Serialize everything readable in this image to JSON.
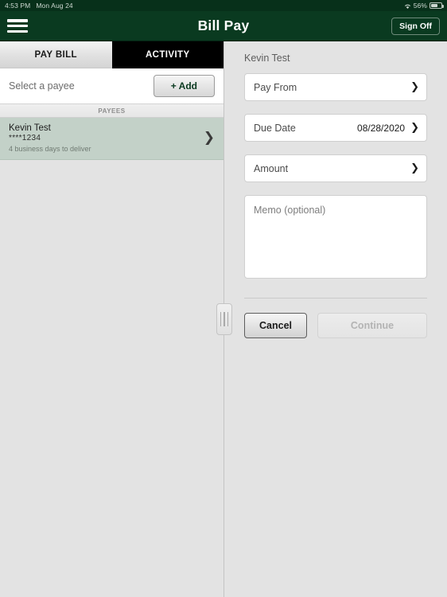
{
  "status_bar": {
    "time": "4:53 PM",
    "date": "Mon Aug 24",
    "wifi_icon": "wifi-icon",
    "battery_percent": "56%",
    "battery_icon": "battery-icon"
  },
  "nav": {
    "menu_icon": "hamburger-menu-icon",
    "title": "Bill Pay",
    "sign_off_label": "Sign Off"
  },
  "tabs": [
    {
      "label": "PAY BILL",
      "active": true
    },
    {
      "label": "ACTIVITY",
      "active": false
    }
  ],
  "payee_panel": {
    "select_label": "Select a payee",
    "add_button_label": "+ Add",
    "section_header": "PAYEES",
    "payees": [
      {
        "name": "Kevin Test",
        "account": "****1234",
        "delivery": "4 business days to deliver",
        "chevron_icon": "chevron-right-icon",
        "selected": true
      }
    ]
  },
  "drag_handle": {
    "icon": "drag-handle-icon"
  },
  "form": {
    "title": "Kevin Test",
    "fields": [
      {
        "label": "Pay From",
        "value": "",
        "chevron_icon": "chevron-right-icon"
      },
      {
        "label": "Due Date",
        "value": "08/28/2020",
        "chevron_icon": "chevron-right-icon"
      },
      {
        "label": "Amount",
        "value": "",
        "chevron_icon": "chevron-right-icon"
      }
    ],
    "memo_placeholder": "Memo (optional)",
    "memo_value": "",
    "cancel_label": "Cancel",
    "continue_label": "Continue",
    "continue_disabled": true
  },
  "colors": {
    "brand_green": "#0a3a20",
    "status_bar_green": "#07301a",
    "panel_background": "#e3e3e3",
    "selected_row": "#c3d1c8",
    "tab_inactive": "#000000",
    "field_white": "#ffffff"
  }
}
